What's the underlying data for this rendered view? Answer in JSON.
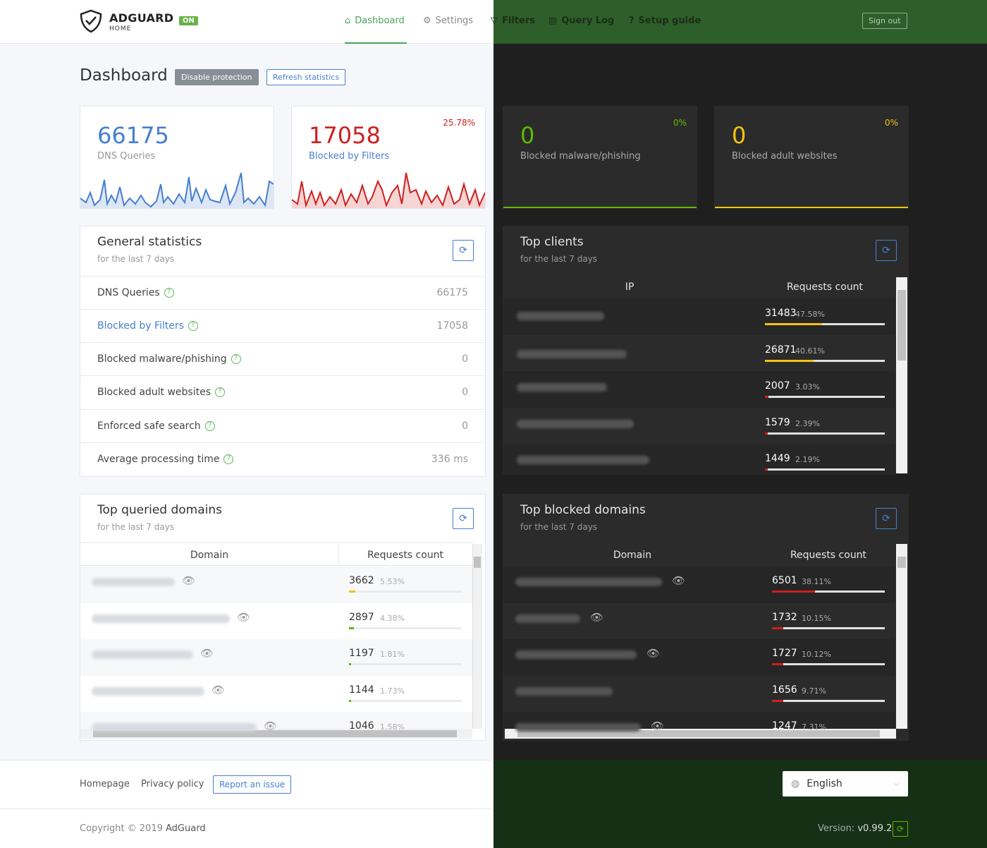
{
  "header": {
    "logo_title": "ADGUARD",
    "logo_sub": "HOME",
    "status_badge": "ON",
    "nav": [
      {
        "label": "Dashboard"
      },
      {
        "label": "Settings"
      },
      {
        "label": "Filters"
      },
      {
        "label": "Query Log"
      },
      {
        "label": "Setup guide"
      }
    ],
    "sign_out": "Sign out"
  },
  "toolbar": {
    "title": "Dashboard",
    "disable_protection": "Disable protection",
    "refresh_statistics": "Refresh statistics"
  },
  "summary": [
    {
      "value": "66175",
      "label": "DNS Queries",
      "percent": "",
      "color": "#467fcf"
    },
    {
      "value": "17058",
      "label": "Blocked by Filters",
      "percent": "25.78%",
      "color": "#cd201f"
    },
    {
      "value": "0",
      "label": "Blocked malware/phishing",
      "percent": "0%",
      "color": "#5eba00"
    },
    {
      "value": "0",
      "label": "Blocked adult websites",
      "percent": "0%",
      "color": "#f1c40f"
    }
  ],
  "general": {
    "title": "General statistics",
    "subtitle": "for the last 7 days",
    "rows": [
      {
        "label": "DNS Queries",
        "value": "66175"
      },
      {
        "label": "Blocked by Filters",
        "value": "17058"
      },
      {
        "label": "Blocked malware/phishing",
        "value": "0"
      },
      {
        "label": "Blocked adult websites",
        "value": "0"
      },
      {
        "label": "Enforced safe search",
        "value": "0"
      },
      {
        "label": "Average processing time",
        "value": "336 ms"
      }
    ]
  },
  "top_clients": {
    "title": "Top clients",
    "subtitle": "for the last 7 days",
    "col_ip": "IP",
    "col_count": "Requests count",
    "rows": [
      {
        "count": "31483",
        "pct": "47.58%",
        "fill": 0.4758,
        "bar": "#f1c40f"
      },
      {
        "count": "26871",
        "pct": "40.61%",
        "fill": 0.4061,
        "bar": "#f1c40f"
      },
      {
        "count": "2007",
        "pct": "3.03%",
        "fill": 0.0303,
        "bar": "#cd201f"
      },
      {
        "count": "1579",
        "pct": "2.39%",
        "fill": 0.0239,
        "bar": "#cd201f"
      },
      {
        "count": "1449",
        "pct": "2.19%",
        "fill": 0.0219,
        "bar": "#cd201f"
      }
    ]
  },
  "top_queried": {
    "title": "Top queried domains",
    "subtitle": "for the last 7 days",
    "col_domain": "Domain",
    "col_count": "Requests count",
    "rows": [
      {
        "count": "3662",
        "pct": "5.53%",
        "fill": 0.0553,
        "bar": "#f1c40f"
      },
      {
        "count": "2897",
        "pct": "4.38%",
        "fill": 0.0438,
        "bar": "#5eba00"
      },
      {
        "count": "1197",
        "pct": "1.81%",
        "fill": 0.0181,
        "bar": "#5eba00"
      },
      {
        "count": "1144",
        "pct": "1.73%",
        "fill": 0.0173,
        "bar": "#5eba00"
      },
      {
        "count": "1046",
        "pct": "1.58%",
        "fill": 0.0158,
        "bar": "#5eba00"
      }
    ]
  },
  "top_blocked": {
    "title": "Top blocked domains",
    "subtitle": "for the last 7 days",
    "col_domain": "Domain",
    "col_count": "Requests count",
    "rows": [
      {
        "count": "6501",
        "pct": "38.11%",
        "fill": 0.3811,
        "bar": "#cd201f"
      },
      {
        "count": "1732",
        "pct": "10.15%",
        "fill": 0.1015,
        "bar": "#cd201f"
      },
      {
        "count": "1727",
        "pct": "10.12%",
        "fill": 0.1012,
        "bar": "#cd201f"
      },
      {
        "count": "1656",
        "pct": "9.71%",
        "fill": 0.0971,
        "bar": "#cd201f"
      },
      {
        "count": "1247",
        "pct": "7.31%",
        "fill": 0.0731,
        "bar": "#cd201f"
      }
    ]
  },
  "footer": {
    "homepage": "Homepage",
    "privacy": "Privacy policy",
    "report": "Report an issue",
    "copyright": "Copyright © 2019",
    "copyright_brand": "AdGuard",
    "language": "English",
    "version_label": "Version:",
    "version": "v0.99.2"
  },
  "icons": {
    "dashboard": "home-icon",
    "settings": "gear-icon",
    "filters": "filter-icon",
    "querylog": "document-icon",
    "setup": "help-circle-icon",
    "refresh": "refresh-icon",
    "eye": "eye-icon",
    "globe": "globe-icon",
    "chevron": "chevron-down-icon"
  }
}
